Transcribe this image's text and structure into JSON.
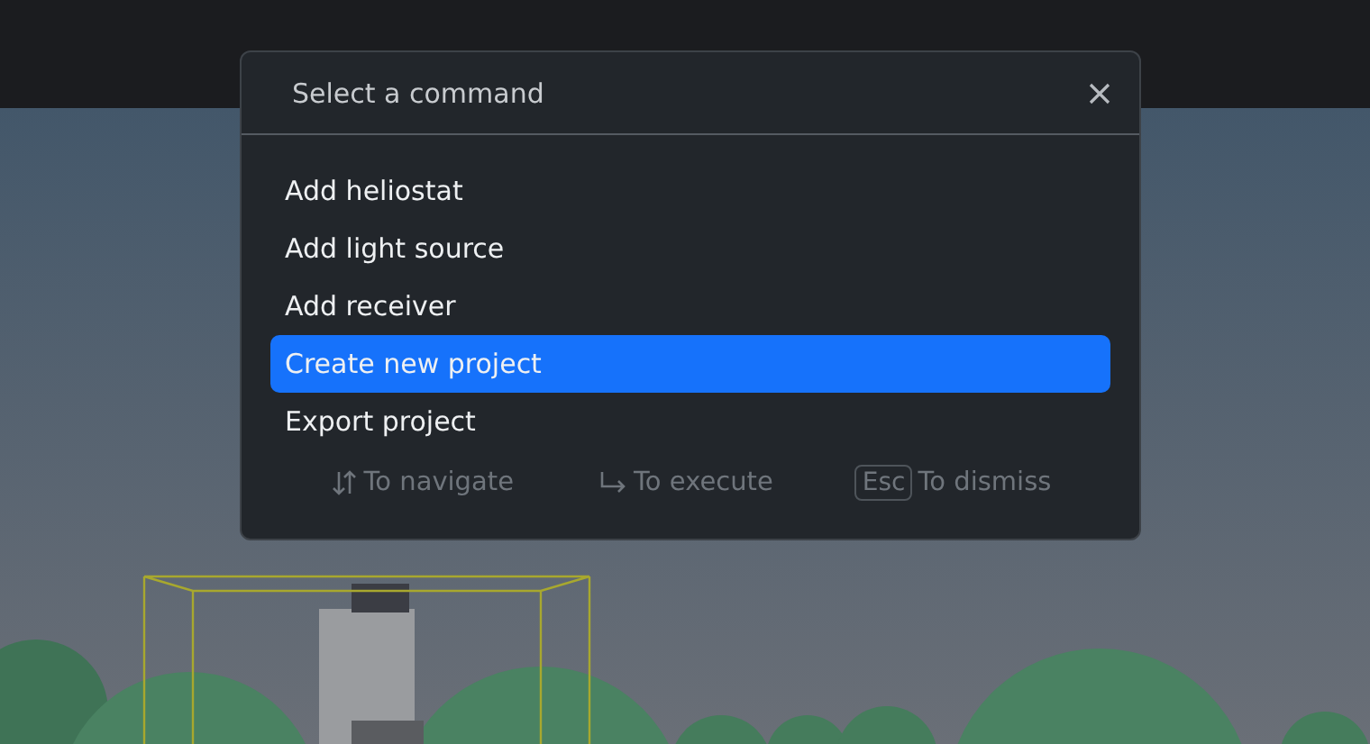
{
  "dialog": {
    "title": "Select a command",
    "commands": [
      {
        "label": "Add heliostat",
        "selected": false
      },
      {
        "label": "Add light source",
        "selected": false
      },
      {
        "label": "Add receiver",
        "selected": false
      },
      {
        "label": "Create new project",
        "selected": true
      },
      {
        "label": "Export project",
        "selected": false
      }
    ],
    "hints": [
      {
        "kind": "arrows",
        "text": "To navigate"
      },
      {
        "kind": "return",
        "text": "To execute"
      },
      {
        "kind": "key",
        "key": "Esc",
        "text": "To dismiss"
      }
    ]
  }
}
